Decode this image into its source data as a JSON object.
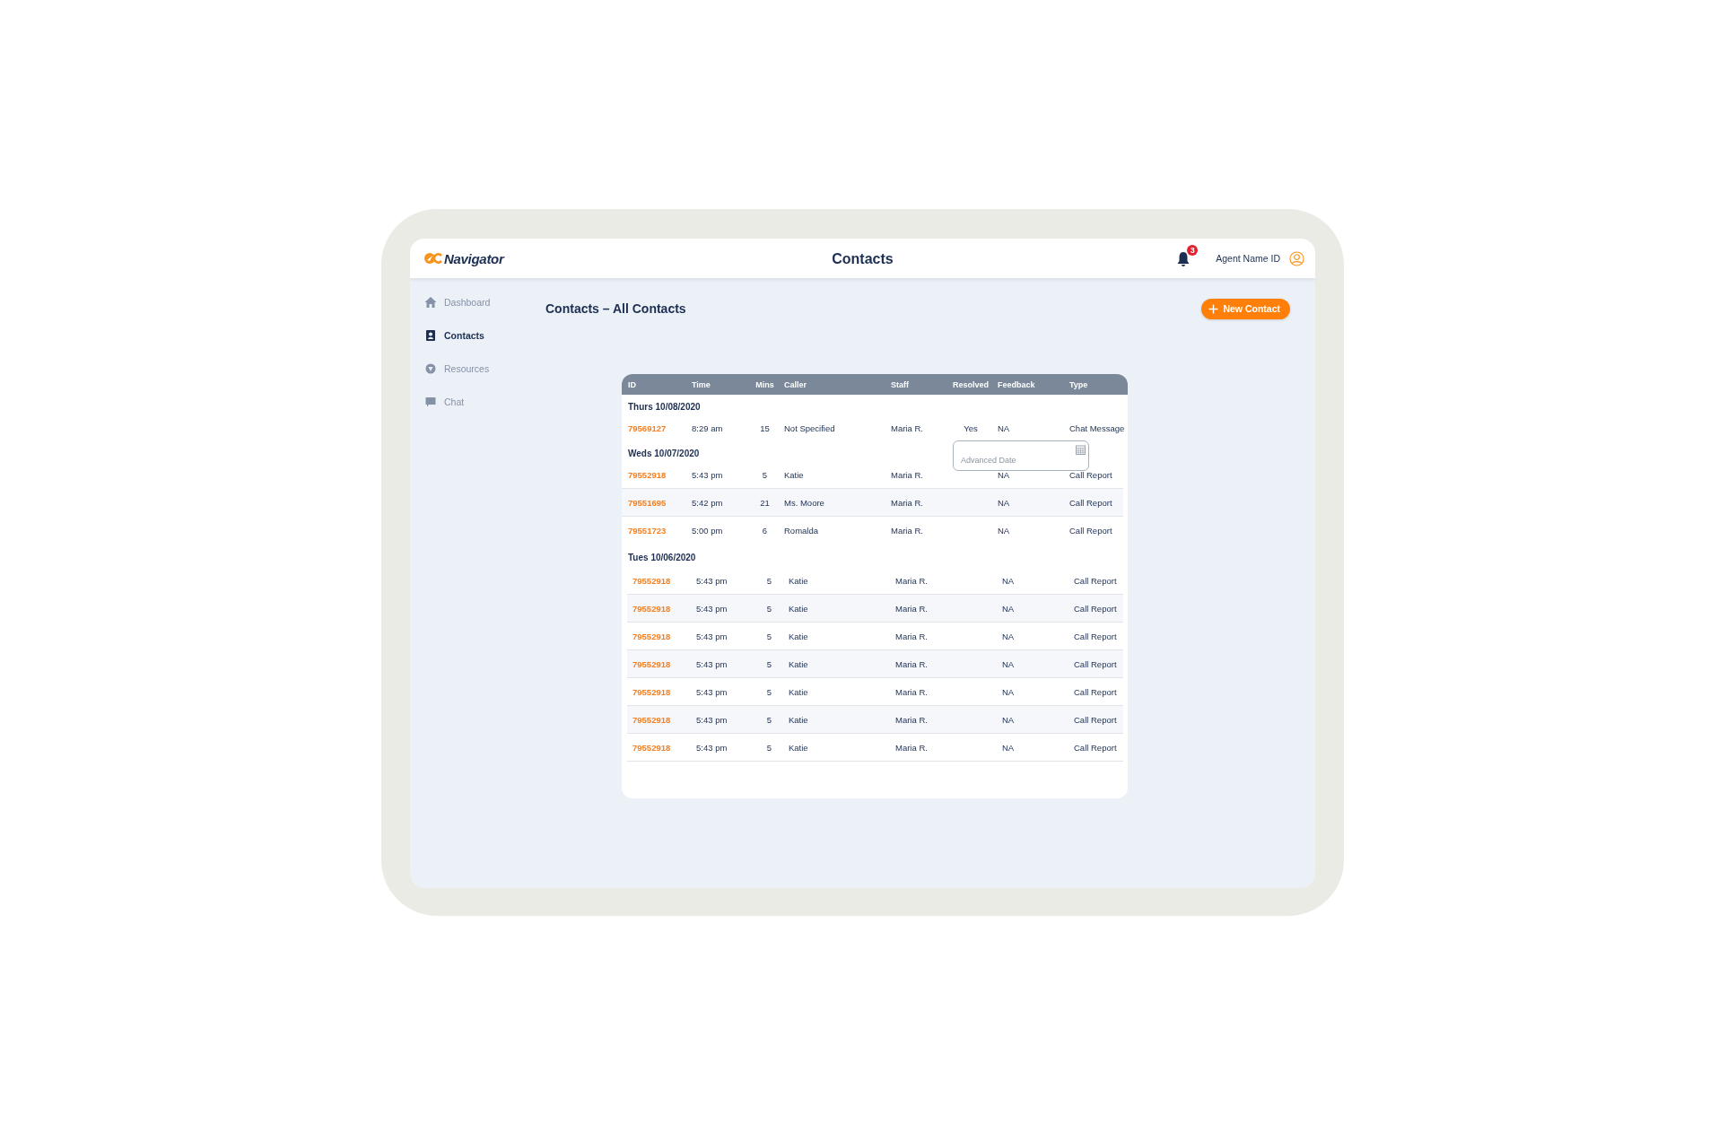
{
  "header": {
    "logo": "Navigator",
    "title": "Contacts",
    "notifications": "3",
    "user": "Agent Name ID"
  },
  "sidebar": {
    "items": [
      {
        "label": "Dashboard",
        "selected": false
      },
      {
        "label": "Contacts",
        "selected": true
      },
      {
        "label": "Resources",
        "selected": false
      },
      {
        "label": "Chat",
        "selected": false
      }
    ]
  },
  "page_title": "Contacts – All Contacts",
  "new_button": "New Contact",
  "table": {
    "columns": [
      "ID",
      "Time",
      "Mins",
      "Caller",
      "Staff",
      "Resolved",
      "Feedback",
      "Type"
    ],
    "groups": [
      {
        "date": "Thurs 10/08/2020",
        "rows": [
          {
            "cells": [
              "79569127",
              "8:29 am",
              "15",
              "Not Specified",
              "Maria R.",
              "Yes",
              "NA",
              "Chat Message"
            ]
          }
        ]
      },
      {
        "date": "Weds 10/07/2020",
        "rows": [
          {
            "cells": [
              "79552918",
              "5:43 pm",
              "5",
              "Katie",
              "Maria R.",
              "",
              "NA",
              "Call Report"
            ]
          },
          {
            "cells": [
              "79551695",
              "5:42 pm",
              "21",
              "Ms. Moore",
              "Maria R.",
              "",
              "NA",
              "Call Report"
            ]
          },
          {
            "cells": [
              "79551723",
              "5:00 pm",
              "6",
              "Romalda",
              "Maria R.",
              "",
              "NA",
              "Call Report"
            ]
          }
        ]
      },
      {
        "date": "Tues 10/06/2020",
        "rows": [
          {
            "cells": [
              "79552918",
              "5:43 pm",
              "5",
              "Katie",
              "Maria R.",
              "",
              "NA",
              "Call Report"
            ]
          },
          {
            "cells": [
              "79552918",
              "5:43 pm",
              "5",
              "Katie",
              "Maria R.",
              "",
              "NA",
              "Call Report"
            ]
          },
          {
            "cells": [
              "79552918",
              "5:43 pm",
              "5",
              "Katie",
              "Maria R.",
              "",
              "NA",
              "Call Report"
            ]
          },
          {
            "cells": [
              "79552918",
              "5:43 pm",
              "5",
              "Katie",
              "Maria R.",
              "",
              "NA",
              "Call Report"
            ]
          },
          {
            "cells": [
              "79552918",
              "5:43 pm",
              "5",
              "Katie",
              "Maria R.",
              "",
              "NA",
              "Call Report"
            ]
          },
          {
            "cells": [
              "79552918",
              "5:43 pm",
              "5",
              "Katie",
              "Maria R.",
              "",
              "NA",
              "Call Report"
            ]
          },
          {
            "cells": [
              "79552918",
              "5:43 pm",
              "5",
              "Katie",
              "Maria R.",
              "",
              "NA",
              "Call Report"
            ]
          }
        ]
      }
    ]
  },
  "date_field": {
    "placeholder": "Advanced Date"
  }
}
